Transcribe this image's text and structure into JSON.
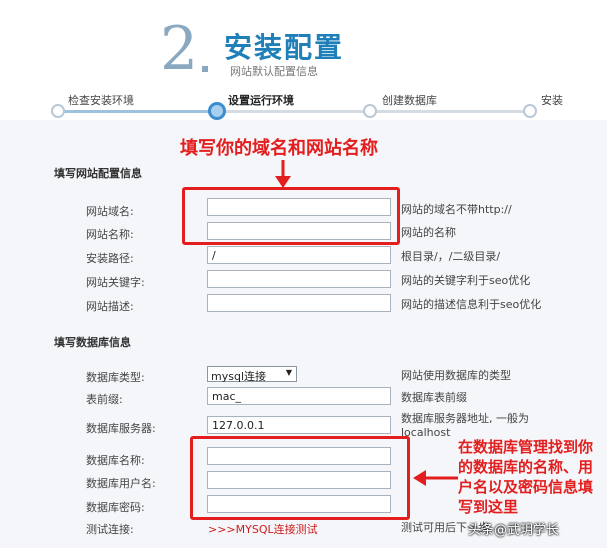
{
  "header": {
    "step_number": "2",
    "title": "安装配置",
    "subtitle": "网站默认配置信息"
  },
  "steps": [
    {
      "label": "检查安装环境",
      "state": "done"
    },
    {
      "label": "设置运行环境",
      "state": "active"
    },
    {
      "label": "创建数据库",
      "state": "pending"
    },
    {
      "label": "安装",
      "state": "pending"
    }
  ],
  "site_section": {
    "title": "填写网站配置信息",
    "fields": [
      {
        "label": "网站域名:",
        "value": "",
        "hint": "网站的域名不带http://"
      },
      {
        "label": "网站名称:",
        "value": "",
        "hint": "网站的名称"
      },
      {
        "label": "安装路径:",
        "value": "/",
        "hint": "根目录/，/二级目录/"
      },
      {
        "label": "网站关键字:",
        "value": "",
        "hint": "网站的关键字利于seo优化"
      },
      {
        "label": "网站描述:",
        "value": "",
        "hint": "网站的描述信息利于seo优化"
      }
    ]
  },
  "db_section": {
    "title": "填写数据库信息",
    "type": {
      "label": "数据库类型:",
      "selected": "mysql连接",
      "hint": "网站使用数据库的类型"
    },
    "prefix": {
      "label": "表前缀:",
      "value": "mac_",
      "hint": "数据库表前缀"
    },
    "server": {
      "label": "数据库服务器:",
      "value": "127.0.0.1",
      "hint": "数据库服务器地址, 一般为localhost"
    },
    "name": {
      "label": "数据库名称:",
      "value": ""
    },
    "user": {
      "label": "数据库用户名:",
      "value": ""
    },
    "password": {
      "label": "数据库密码:",
      "value": ""
    },
    "test": {
      "label": "测试连接:",
      "link": ">>>MYSQL连接测试",
      "hint": "测试可用后下一步"
    }
  },
  "annotations": {
    "top": "填写你的域名和网站名称",
    "right": "在数据库管理找到你的数据库的名称、用户名以及密码信息填写到这里"
  },
  "watermark": "头条@武玥学长",
  "colors": {
    "annotation": "#e31e1e",
    "accent": "#3b8ed0",
    "link": "#cc1d1d"
  }
}
